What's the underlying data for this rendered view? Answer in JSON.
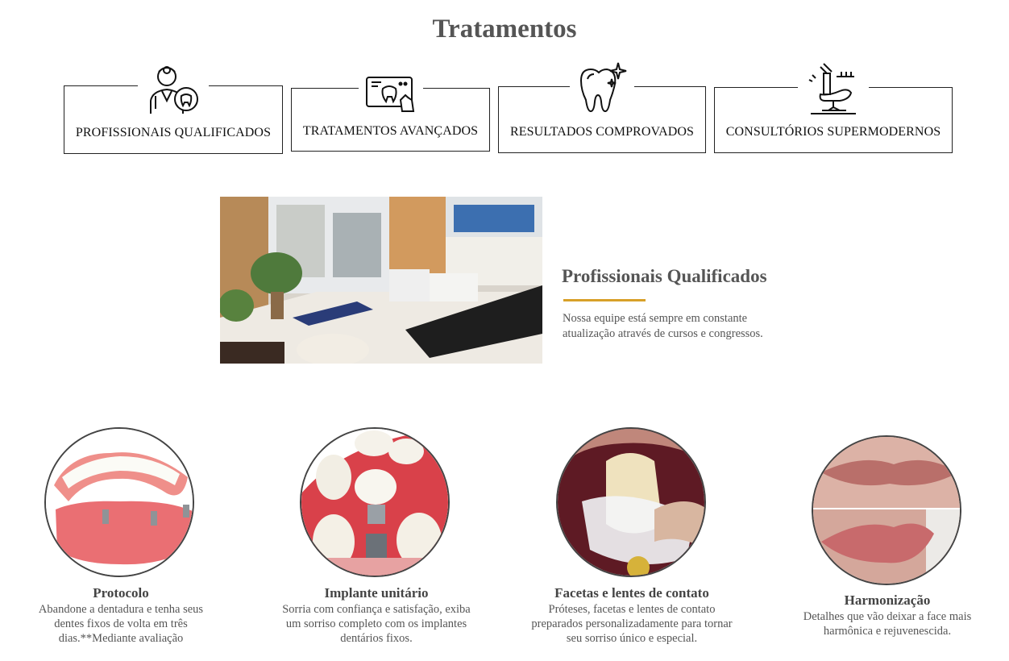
{
  "page": {
    "title": "Tratamentos"
  },
  "features": [
    {
      "label": "PROFISSIONAIS QUALIFICADOS",
      "icon": "dentist-icon"
    },
    {
      "label": "TRATAMENTOS AVANÇADOS",
      "icon": "tablet-tooth-icon"
    },
    {
      "label": "RESULTADOS COMPROVADOS",
      "icon": "sparkling-tooth-icon"
    },
    {
      "label": "CONSULTÓRIOS SUPERMODERNOS",
      "icon": "dental-chair-icon"
    }
  ],
  "highlight": {
    "title": "Profissionais Qualificados",
    "text": "Nossa equipe está sempre em constante atualização através de cursos e congressos.",
    "accent_color": "#d8a028"
  },
  "treatments": [
    {
      "name": "Protocolo",
      "description": "Abandone a dentadura e tenha seus dentes fixos de volta em três dias.**Mediante avaliação"
    },
    {
      "name": "Implante unitário",
      "description": "Sorria com confiança e satisfação, exiba um sorriso completo com os implantes dentários fixos."
    },
    {
      "name": "Facetas e lentes de contato",
      "description": "Próteses, facetas e lentes de contato preparados personalizadamente para tornar seu sorriso único e especial."
    },
    {
      "name": "Harmonização",
      "description": "Detalhes que vão deixar a face mais harmônica e rejuvenescida."
    }
  ]
}
